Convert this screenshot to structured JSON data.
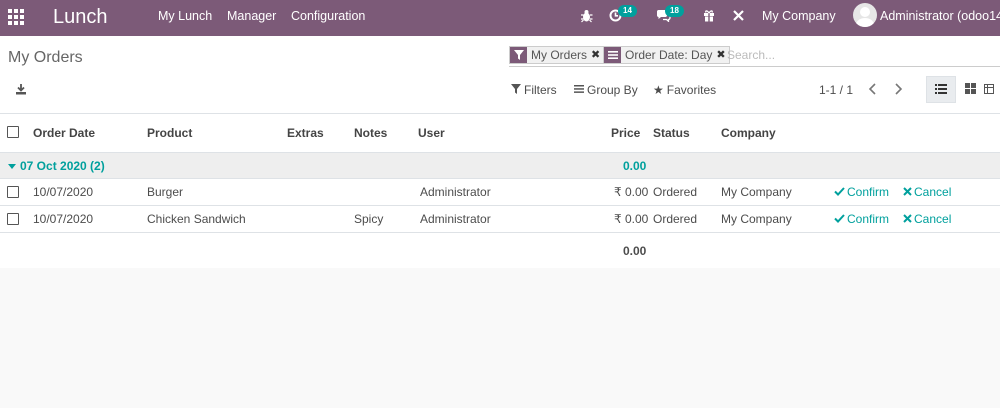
{
  "navbar": {
    "brand": "Lunch",
    "menu": [
      "My Lunch",
      "Manager",
      "Configuration"
    ],
    "activity_count": "14",
    "messages_count": "18",
    "company": "My Company",
    "user": "Administrator (odoo14_"
  },
  "control_panel": {
    "breadcrumb": "My Orders",
    "facets": [
      {
        "icon": "filter-icon",
        "label": "My Orders"
      },
      {
        "icon": "group-by-icon",
        "label": "Order Date: Day"
      }
    ],
    "search_placeholder": "Search...",
    "filters_label": "Filters",
    "group_by_label": "Group By",
    "favorites_label": "Favorites",
    "pager_value": "1-1 / 1"
  },
  "list": {
    "columns": [
      "Order Date",
      "Product",
      "Extras",
      "Notes",
      "User",
      "Price",
      "Status",
      "Company"
    ],
    "group": {
      "label": "07 Oct 2020 (2)",
      "total": "0.00"
    },
    "rows": [
      {
        "order_date": "10/07/2020",
        "product": "Burger",
        "extras": "",
        "notes": "",
        "user": "Administrator",
        "price": "₹ 0.00",
        "status": "Ordered",
        "company": "My Company",
        "confirm": "Confirm",
        "cancel": "Cancel"
      },
      {
        "order_date": "10/07/2020",
        "product": "Chicken Sandwich",
        "extras": "",
        "notes": "Spicy",
        "user": "Administrator",
        "price": "₹ 0.00",
        "status": "Ordered",
        "company": "My Company",
        "confirm": "Confirm",
        "cancel": "Cancel"
      }
    ],
    "footer_total": "0.00"
  },
  "colors": {
    "navbar": "#7c5a78",
    "accent": "#00a09d"
  }
}
